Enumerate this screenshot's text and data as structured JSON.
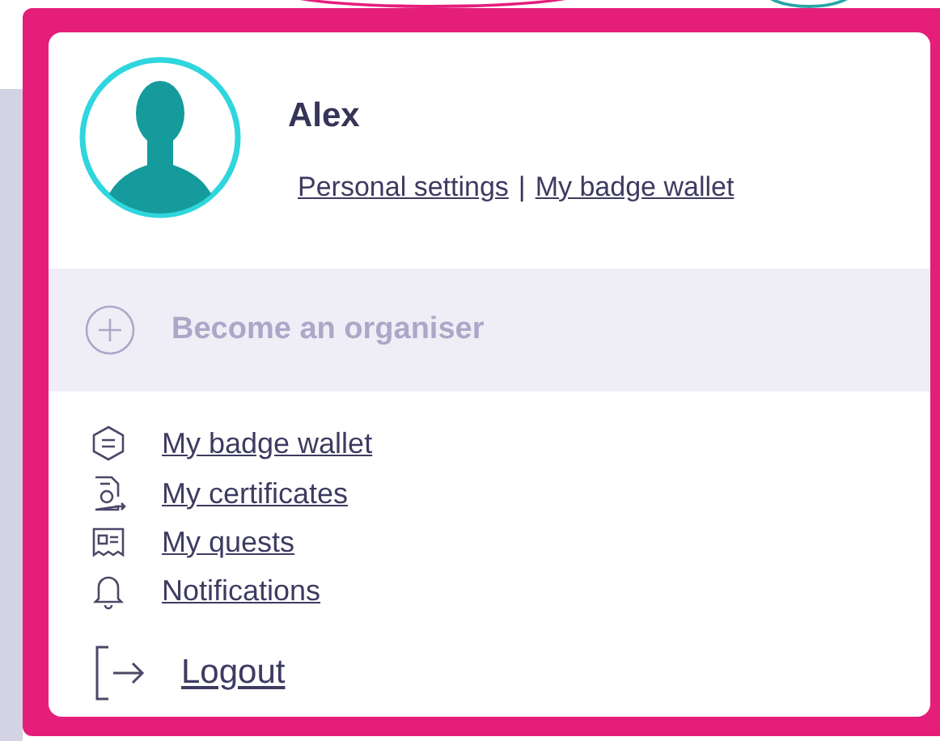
{
  "user": {
    "name": "Alex",
    "links": [
      "Personal settings",
      "My badge wallet"
    ],
    "separator": "|"
  },
  "organiser": {
    "label": "Become an organiser",
    "disabled": true
  },
  "menu": [
    {
      "kind": "badge",
      "label": "My badge wallet"
    },
    {
      "kind": "certificate",
      "label": "My certificates"
    },
    {
      "kind": "quests",
      "label": "My quests"
    },
    {
      "kind": "bell",
      "label": "Notifications"
    }
  ],
  "logout": {
    "label": "Logout"
  }
}
